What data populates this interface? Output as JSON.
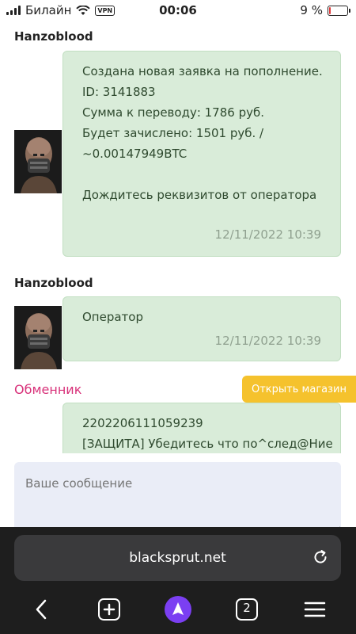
{
  "status_bar": {
    "carrier": "Билайн",
    "vpn": "VPN",
    "time": "00:06",
    "battery": "9 %",
    "battery_level": 0.09,
    "battery_color": "#e03a3a"
  },
  "messages": [
    {
      "sender": "Hanzoblood",
      "text": "Создана новая заявка на пополнение.\nID: 3141883\nСумма к переводу: 1786 руб.\nБудет зачислено: 1501 руб. /\n~0.00147949BTC\n\nДождитесь реквизитов от оператора",
      "timestamp": "12/11/2022 10:39"
    },
    {
      "sender": "Hanzoblood",
      "text": "Оператор",
      "timestamp": "12/11/2022 10:39"
    },
    {
      "text": "2202206111059239\n[ЗАЩИТА] Убедитесь что по^след@Ние"
    }
  ],
  "exchange_link": "Обменник",
  "open_shop_button": "Открыть магазин",
  "message_input": {
    "placeholder": "Ваше сообщение"
  },
  "browser": {
    "url": "blacksprut.net",
    "tab_count": "2"
  },
  "colors": {
    "bubble_bg": "#d9ecd9",
    "accent_pink": "#d8327a",
    "button_yellow": "#f5c22d",
    "browser_dark": "#1e1e1e",
    "alice_purple": "#7b3ff2"
  }
}
